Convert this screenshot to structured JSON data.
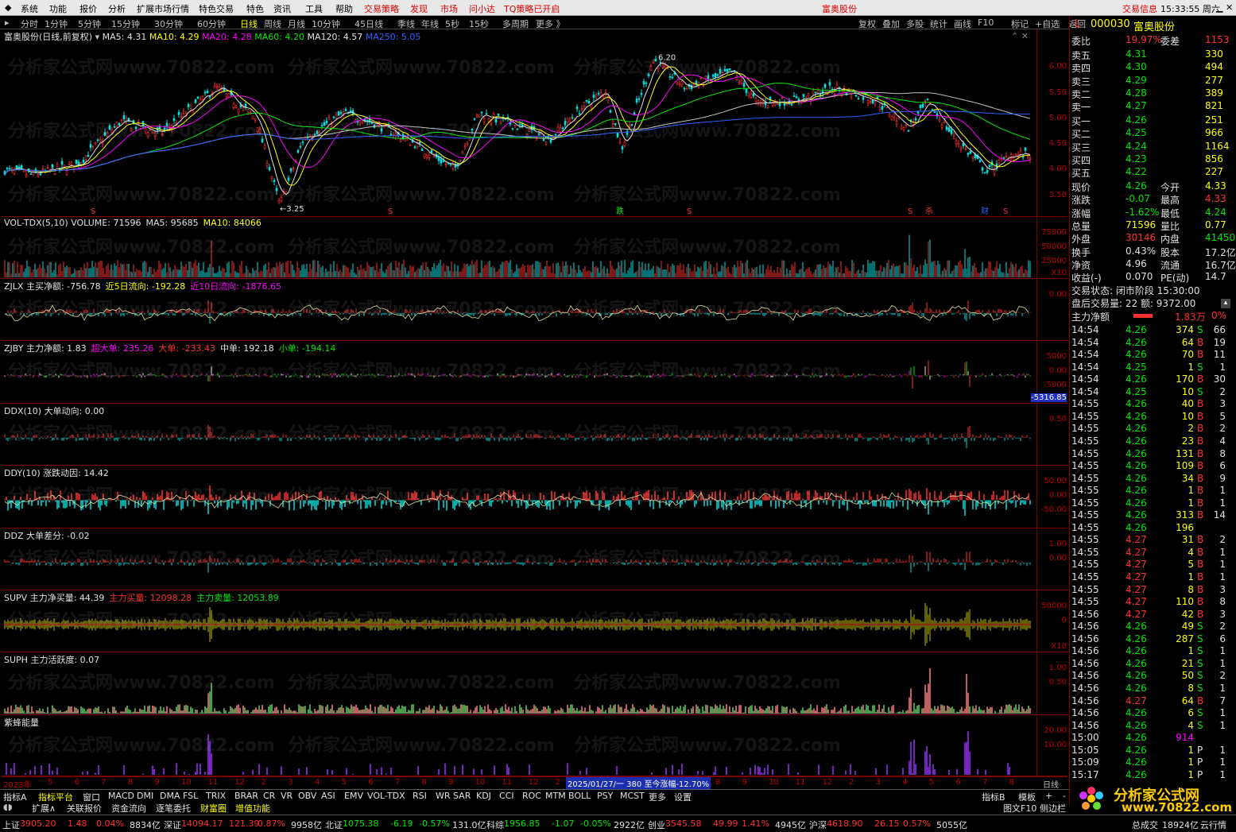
{
  "menu": {
    "items": [
      "系统",
      "功能",
      "报价",
      "分析",
      "扩展市场行情",
      "特色交易",
      "特色",
      "资讯",
      "工具",
      "帮助"
    ],
    "strategy": "交易策略",
    "find": "发现",
    "market": "市场",
    "ask": "问小达",
    "tq": "TQ策略已开启",
    "center_title": "富奥股份",
    "trade_info": "交易信息",
    "clock": "15:33:55 周六"
  },
  "periods": [
    "分时",
    "1分钟",
    "5分钟",
    "15分钟",
    "30分钟",
    "60分钟",
    "日线",
    "周线",
    "月线",
    "10分钟",
    "45日线",
    "季线",
    "年线",
    "5秒",
    "15秒",
    "多周期",
    "更多 》"
  ],
  "active_period": "日线",
  "toolbar": [
    "复权",
    "叠加",
    "多股",
    "统计",
    "画线",
    "F10",
    "标记",
    "+自选",
    "返回"
  ],
  "main_chart": {
    "label": "富奥股份(日线,前复权)",
    "ma5": "MA5: 4.31",
    "ma10": "MA10: 4.29",
    "ma20": "MA20: 4.28",
    "ma60": "MA60: 4.20",
    "ma120": "MA120: 4.57",
    "ma250": "MA250: 5.05",
    "ticks": [
      "6.00",
      "5.50",
      "5.00",
      "4.50",
      "4.00",
      "3.50"
    ],
    "high_label": "6.20",
    "low_label": "3.25",
    "markers": [
      "S",
      "S",
      "跌",
      "S",
      "S",
      "杀",
      "财",
      "S"
    ]
  },
  "watermark": "分析家公式网www.70822.com",
  "panes": [
    {
      "name": "vol",
      "title": "VOL-TDX(5,10)",
      "parts": [
        "VOLUME: 71596",
        "MA5: 95685",
        "MA10: 84066"
      ],
      "ticks": [
        "75000",
        "50000",
        "25000"
      ],
      "extra": "X10"
    },
    {
      "name": "zjlx",
      "title": "ZJLX",
      "parts": [
        "主买净额: -756.78",
        "近5日流向: -192.28",
        "近10日流向: -1876.65"
      ],
      "ticks": [
        "0.00"
      ]
    },
    {
      "name": "zjby",
      "title": "ZJBY",
      "parts": [
        "主力净额: 1.83",
        "超大单: 235.26",
        "大单: -233.43",
        "中单: 192.18",
        "小单: -194.14"
      ],
      "ticks": [
        "5000",
        "0.00",
        "-5000"
      ],
      "extra": "-5316.85"
    },
    {
      "name": "ddx",
      "title": "DDX(10)",
      "parts": [
        "大单动向: 0.00"
      ],
      "ticks": [
        "0.50"
      ]
    },
    {
      "name": "ddy",
      "title": "DDY(10)",
      "parts": [
        "涨跌动因: 14.42"
      ],
      "ticks": [
        "50.00",
        "0.00",
        "-50.00"
      ]
    },
    {
      "name": "ddz",
      "title": "DDZ",
      "parts": [
        "大单差分: -0.02"
      ],
      "ticks": [
        "1.00",
        "0.00"
      ]
    },
    {
      "name": "supv",
      "title": "SUPV",
      "parts": [
        "主力净买量: 44.39",
        "主力买量: 12098.28",
        "主力卖量: 12053.89"
      ],
      "ticks": [
        "50000",
        "0"
      ],
      "extra": "X10"
    },
    {
      "name": "suph",
      "title": "SUPH",
      "parts": [
        "主力活跃度: 0.07"
      ],
      "ticks": [
        "1.00",
        "0.50"
      ]
    },
    {
      "name": "zfnl",
      "title": "紫蜂能量",
      "parts": [],
      "ticks": [
        "20.00",
        "10.00"
      ]
    }
  ],
  "date_axis": {
    "year": "2023年",
    "labels": [
      "5",
      "6",
      "7",
      "8",
      "9",
      "10",
      "11",
      "12",
      "2",
      "3",
      "4",
      "5",
      "6",
      "7",
      "8",
      "9",
      "10",
      "11",
      "12",
      "2",
      "3",
      "4",
      "5",
      "6",
      "7",
      "8",
      "9",
      "10",
      "11",
      "12",
      "2",
      "3",
      "4",
      "5",
      "6",
      "7",
      "8"
    ],
    "highlight": "2025/01/27/一 380 至今涨幅-12.70%",
    "unit": "日线"
  },
  "quote": {
    "code": "000030",
    "name": "富奥股份",
    "weibi": {
      "label": "委比",
      "value": "19.97%",
      "label2": "委差",
      "value2": "1153"
    },
    "asks": [
      {
        "l": "卖五",
        "p": "4.31",
        "v": "330"
      },
      {
        "l": "卖四",
        "p": "4.30",
        "v": "494"
      },
      {
        "l": "卖三",
        "p": "4.29",
        "v": "277"
      },
      {
        "l": "卖二",
        "p": "4.28",
        "v": "389"
      },
      {
        "l": "卖一",
        "p": "4.27",
        "v": "821"
      }
    ],
    "bids": [
      {
        "l": "买一",
        "p": "4.26",
        "v": "251"
      },
      {
        "l": "买二",
        "p": "4.25",
        "v": "966"
      },
      {
        "l": "买三",
        "p": "4.24",
        "v": "1164"
      },
      {
        "l": "买四",
        "p": "4.23",
        "v": "856"
      },
      {
        "l": "买五",
        "p": "4.22",
        "v": "227"
      }
    ],
    "stats": [
      {
        "a": "现价",
        "av": "4.26",
        "b": "今开",
        "bv": "4.33"
      },
      {
        "a": "涨跌",
        "av": "-0.07",
        "b": "最高",
        "bv": "4.33"
      },
      {
        "a": "涨幅",
        "av": "-1.62%",
        "b": "最低",
        "bv": "4.24"
      },
      {
        "a": "总量",
        "av": "71596",
        "b": "量比",
        "bv": "0.77"
      },
      {
        "a": "外盘",
        "av": "30146",
        "b": "内盘",
        "bv": "41450"
      },
      {
        "a": "换手",
        "av": "0.43%",
        "b": "股本",
        "bv": "17.2亿"
      },
      {
        "a": "净资",
        "av": "4.96",
        "b": "流通",
        "bv": "16.7亿"
      },
      {
        "a": "收益(-)",
        "av": "0.070",
        "b": "PE(动)",
        "bv": "14.7"
      }
    ],
    "trade_state": "交易状态: 闭市阶段 15:30:00",
    "after_hours": "盘后交易量: 22  额: 9372.00",
    "main_net": {
      "label": "主力净额",
      "value": "1.83万",
      "pct": "0%"
    }
  },
  "ticks": [
    [
      "14:54",
      "4.26",
      "374",
      "S",
      "66"
    ],
    [
      "14:54",
      "4.26",
      "64",
      "B",
      "19"
    ],
    [
      "14:54",
      "4.26",
      "70",
      "B",
      "11"
    ],
    [
      "14:54",
      "4.25",
      "1",
      "S",
      "1"
    ],
    [
      "14:54",
      "4.26",
      "170",
      "B",
      "30"
    ],
    [
      "14:54",
      "4.25",
      "10",
      "S",
      "2"
    ],
    [
      "14:55",
      "4.26",
      "40",
      "B",
      "3"
    ],
    [
      "14:55",
      "4.26",
      "10",
      "B",
      "5"
    ],
    [
      "14:55",
      "4.26",
      "2",
      "B",
      "2"
    ],
    [
      "14:55",
      "4.26",
      "23",
      "B",
      "4"
    ],
    [
      "14:55",
      "4.26",
      "131",
      "B",
      "8"
    ],
    [
      "14:55",
      "4.26",
      "109",
      "B",
      "6"
    ],
    [
      "14:55",
      "4.26",
      "34",
      "B",
      "9"
    ],
    [
      "14:55",
      "4.26",
      "1",
      "B",
      "1"
    ],
    [
      "14:55",
      "4.26",
      "1",
      "B",
      "1"
    ],
    [
      "14:55",
      "4.26",
      "313",
      "B",
      "14"
    ],
    [
      "14:55",
      "4.26",
      "196",
      "",
      ""
    ],
    [
      "14:55",
      "4.27",
      "31",
      "B",
      "2"
    ],
    [
      "14:55",
      "4.27",
      "4",
      "B",
      "1"
    ],
    [
      "14:55",
      "4.27",
      "5",
      "B",
      "1"
    ],
    [
      "14:55",
      "4.27",
      "1",
      "B",
      "1"
    ],
    [
      "14:55",
      "4.27",
      "8",
      "B",
      "3"
    ],
    [
      "14:55",
      "4.27",
      "110",
      "B",
      "8"
    ],
    [
      "14:56",
      "4.27",
      "42",
      "B",
      "3"
    ],
    [
      "14:56",
      "4.26",
      "49",
      "S",
      "2"
    ],
    [
      "14:56",
      "4.26",
      "287",
      "S",
      "6"
    ],
    [
      "14:56",
      "4.26",
      "1",
      "S",
      "1"
    ],
    [
      "14:56",
      "4.26",
      "21",
      "S",
      "1"
    ],
    [
      "14:56",
      "4.26",
      "50",
      "S",
      "2"
    ],
    [
      "14:56",
      "4.26",
      "8",
      "S",
      "1"
    ],
    [
      "14:56",
      "4.27",
      "64",
      "B",
      "7"
    ],
    [
      "14:56",
      "4.26",
      "6",
      "S",
      "1"
    ],
    [
      "14:56",
      "4.26",
      "4",
      "S",
      "1"
    ],
    [
      "15:00",
      "4.26",
      "914",
      "",
      ""
    ],
    [
      "15:05",
      "4.26",
      "1",
      "P",
      "1"
    ],
    [
      "15:09",
      "4.26",
      "1",
      "P",
      "1"
    ],
    [
      "15:17",
      "4.26",
      "1",
      "P",
      "1"
    ]
  ],
  "ind_tabs": [
    "指标A",
    "指标平台",
    "窗口",
    "MACD",
    "DMI",
    "DMA",
    "FSL",
    "TRIX",
    "BRAR",
    "CR",
    "VR",
    "OBV",
    "ASI",
    "EMV",
    "VOL-TDX",
    "RSI",
    "WR",
    "SAR",
    "KDJ",
    "CCI",
    "ROC",
    "MTM",
    "BOLL",
    "PSY",
    "MCST",
    "更多",
    "设置"
  ],
  "ind_tabs_right": [
    "指标B",
    "模板",
    "+",
    "-"
  ],
  "func_tabs": [
    "扩展∧",
    "关联报价",
    "资金流向",
    "逐笔委托",
    "财富圈",
    "增值功能"
  ],
  "func_tabs_right": [
    "图文F10",
    "侧边栏"
  ],
  "status": [
    {
      "n": "上证",
      "p": "3905.20",
      "c": "1.48",
      "pc": "0.04%",
      "v": "8834亿"
    },
    {
      "n": "深证",
      "p": "14094.17",
      "c": "121.39",
      "pc": "0.87%",
      "v": "9958亿"
    },
    {
      "n": "北证",
      "p": "1075.38",
      "c": "-6.19",
      "pc": "-0.57%",
      "v": "131.0亿"
    },
    {
      "n": "科综",
      "p": "1956.85",
      "c": "-1.07",
      "pc": "-0.05%",
      "v": "2922亿"
    },
    {
      "n": "创业",
      "p": "3545.58",
      "c": "49.99",
      "pc": "1.41%",
      "v": "4945亿"
    },
    {
      "n": "沪深",
      "p": "4618.90",
      "c": "26.15",
      "pc": "0.57%",
      "v": "5055亿"
    }
  ],
  "status_tail": {
    "total_label": "总成交",
    "total": "18924亿",
    "cloud": "云行情"
  },
  "logo": {
    "name": "分析家公式网",
    "url": "www.70822.com"
  },
  "colors": {
    "up": "#ff3030",
    "down": "#00e600",
    "neutral": "#e0e0e0",
    "border": "#7a0000",
    "ma5": "#e0e0e0",
    "ma10": "#ffff00",
    "ma20": "#ff00ff",
    "ma60": "#00e600",
    "ma120": "#c0c0c0",
    "ma250": "#3060ff"
  }
}
